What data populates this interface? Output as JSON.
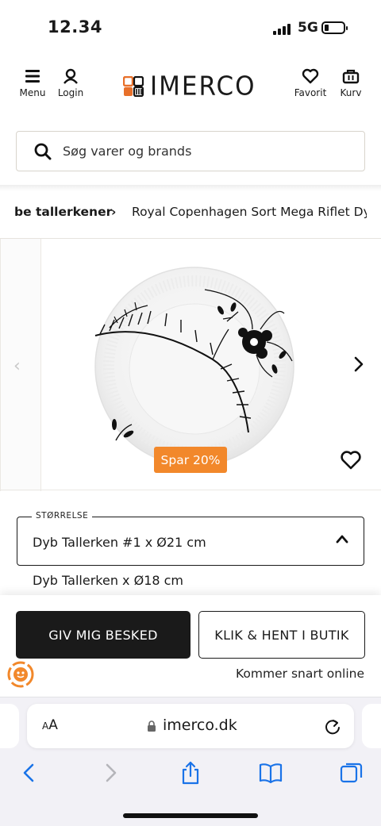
{
  "status_bar": {
    "time": "12.34",
    "network": "5G"
  },
  "header": {
    "menu_label": "Menu",
    "login_label": "Login",
    "logo_text": "IMERCO",
    "favorite_label": "Favorit",
    "cart_label": "Kurv"
  },
  "search": {
    "placeholder": "Søg varer og brands"
  },
  "breadcrumb": {
    "items": [
      "be tallerkener",
      "Royal Copenhagen Sort Mega Riflet Dyb"
    ],
    "separator": "›"
  },
  "product": {
    "discount_badge": "Spar 20%",
    "accent_color": "#f2882b"
  },
  "size_selector": {
    "label": "STØRRELSE",
    "selected": "Dyb Tallerken #1 x Ø21 cm",
    "options": [
      "Dyb Tallerken x Ø18 cm"
    ]
  },
  "actions": {
    "notify_label": "GIV MIG BESKED",
    "pickup_label": "KLIK & HENT I BUTIK",
    "availability_note": "Kommer snart online"
  },
  "browser": {
    "text_size_label_small": "A",
    "text_size_label_large": "A",
    "url": "imerco.dk"
  }
}
